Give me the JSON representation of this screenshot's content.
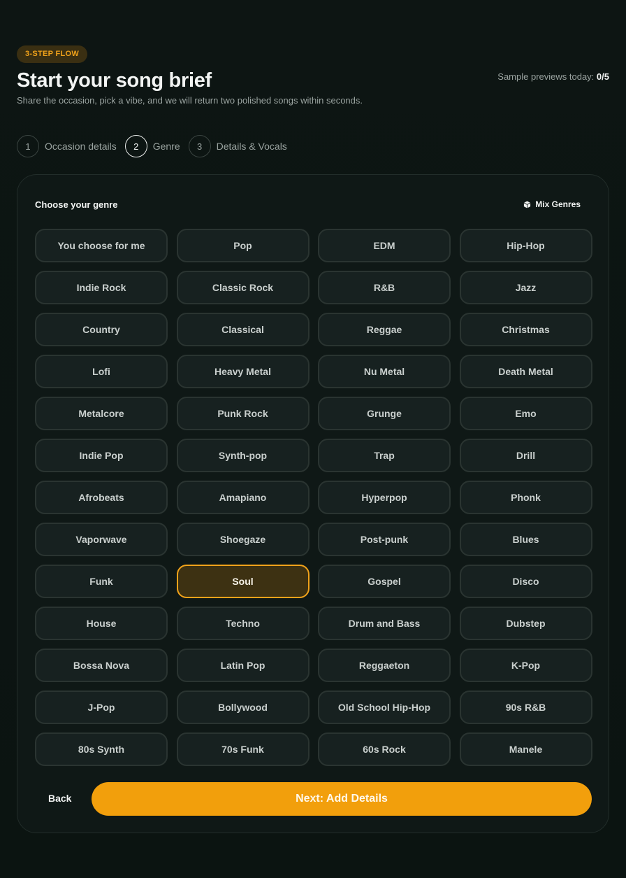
{
  "header": {
    "badge": "3-STEP FLOW",
    "title": "Start your song brief",
    "subtitle": "Share the occasion, pick a vibe, and we will return two polished songs within seconds.",
    "previews_label": "Sample previews today:",
    "previews_value": "0/5"
  },
  "steps": [
    {
      "num": "1",
      "label": "Occasion details"
    },
    {
      "num": "2",
      "label": "Genre"
    },
    {
      "num": "3",
      "label": "Details & Vocals"
    }
  ],
  "card": {
    "heading": "Choose your genre",
    "mix_label": "Mix Genres",
    "selected": "Soul",
    "genres": [
      "You choose for me",
      "Pop",
      "EDM",
      "Hip-Hop",
      "Indie Rock",
      "Classic Rock",
      "R&B",
      "Jazz",
      "Country",
      "Classical",
      "Reggae",
      "Christmas",
      "Lofi",
      "Heavy Metal",
      "Nu Metal",
      "Death Metal",
      "Metalcore",
      "Punk Rock",
      "Grunge",
      "Emo",
      "Indie Pop",
      "Synth-pop",
      "Trap",
      "Drill",
      "Afrobeats",
      "Amapiano",
      "Hyperpop",
      "Phonk",
      "Vaporwave",
      "Shoegaze",
      "Post-punk",
      "Blues",
      "Funk",
      "Soul",
      "Gospel",
      "Disco",
      "House",
      "Techno",
      "Drum and Bass",
      "Dubstep",
      "Bossa Nova",
      "Latin Pop",
      "Reggaeton",
      "K-Pop",
      "J-Pop",
      "Bollywood",
      "Old School Hip-Hop",
      "90s R&B",
      "80s Synth",
      "70s Funk",
      "60s Rock",
      "Manele"
    ],
    "back_label": "Back",
    "next_label": "Next: Add Details"
  },
  "colors": {
    "accent": "#f29f0c",
    "background": "#0d1513"
  }
}
